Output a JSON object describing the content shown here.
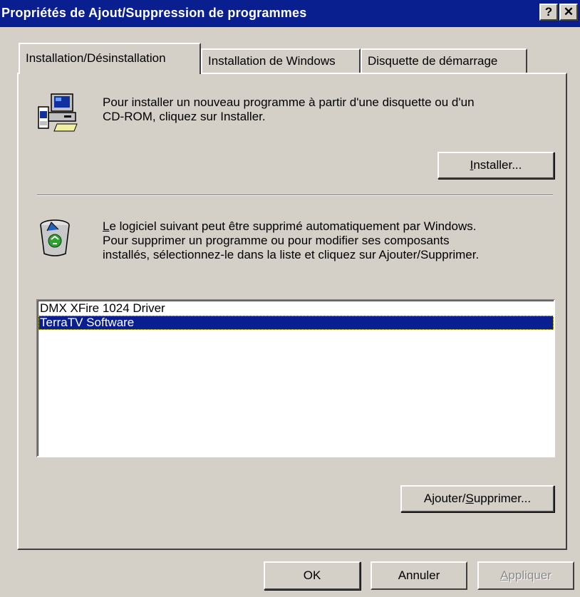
{
  "window": {
    "title": "Propriétés de Ajout/Suppression de programmes",
    "help_label": "?",
    "close_label": "✕"
  },
  "tabs": [
    {
      "label": "Installation/Désinstallation",
      "active": true
    },
    {
      "label": "Installation de Windows",
      "active": false
    },
    {
      "label": "Disquette de démarrage",
      "active": false
    }
  ],
  "install_section": {
    "icon": "computer-install-icon",
    "text_line1": "Pour installer un nouveau programme à partir d'une disquette ou d'un",
    "text_line2": "CD-ROM, cliquez sur Installer.",
    "button_accel": "I",
    "button_rest": "nstaller..."
  },
  "uninstall_section": {
    "icon": "recycle-bin-icon",
    "text_accel": "L",
    "text_line1_rest": "e logiciel suivant peut être supprimé automatiquement par Windows.",
    "text_line2": "Pour supprimer un programme ou pour modifier ses composants",
    "text_line3": "installés, sélectionnez-le dans la liste et cliquez sur Ajouter/Supprimer.",
    "programs": [
      {
        "name": "DMX XFire 1024 Driver",
        "selected": false
      },
      {
        "name": "TerraTV Software",
        "selected": true
      }
    ],
    "button_pre": "Ajouter/",
    "button_accel": "S",
    "button_rest": "upprimer..."
  },
  "footer": {
    "ok_label": "OK",
    "cancel_label": "Annuler",
    "apply_accel": "A",
    "apply_rest": "ppliquer",
    "apply_enabled": false
  },
  "colors": {
    "titlebar": "#0a1f8f",
    "face": "#d4d0c8",
    "selection": "#0a1f8f"
  }
}
